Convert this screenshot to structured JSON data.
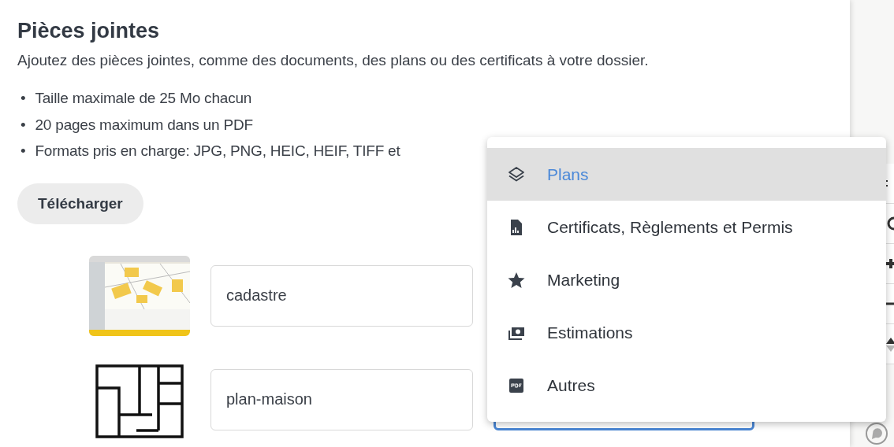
{
  "section": {
    "title": "Pièces jointes",
    "description": "Ajoutez des pièces jointes, comme des documents, des plans ou des certificats à votre dossier.",
    "rules": [
      {
        "bullet": "•",
        "text": "Taille maximale de 25 Mo chacun"
      },
      {
        "bullet": "•",
        "text": "20 pages maximum dans un PDF"
      },
      {
        "bullet": "•",
        "text": "Formats pris en charge: JPG, PNG, HEIC, HEIF, TIFF et"
      }
    ],
    "upload_button": "Télécharger"
  },
  "attachments": [
    {
      "name": "cadastre"
    },
    {
      "name": "plan-maison",
      "category_field": {
        "focused": true
      }
    }
  ],
  "dropdown": {
    "items": [
      {
        "kind": "layers",
        "label": "Plans",
        "selected": true
      },
      {
        "kind": "report",
        "label": "Certificats, Règlements et Permis",
        "selected": false
      },
      {
        "kind": "star",
        "label": "Marketing",
        "selected": false
      },
      {
        "kind": "money",
        "label": "Estimations",
        "selected": false
      },
      {
        "kind": "pdf",
        "label": "Autres",
        "selected": false
      }
    ]
  }
}
